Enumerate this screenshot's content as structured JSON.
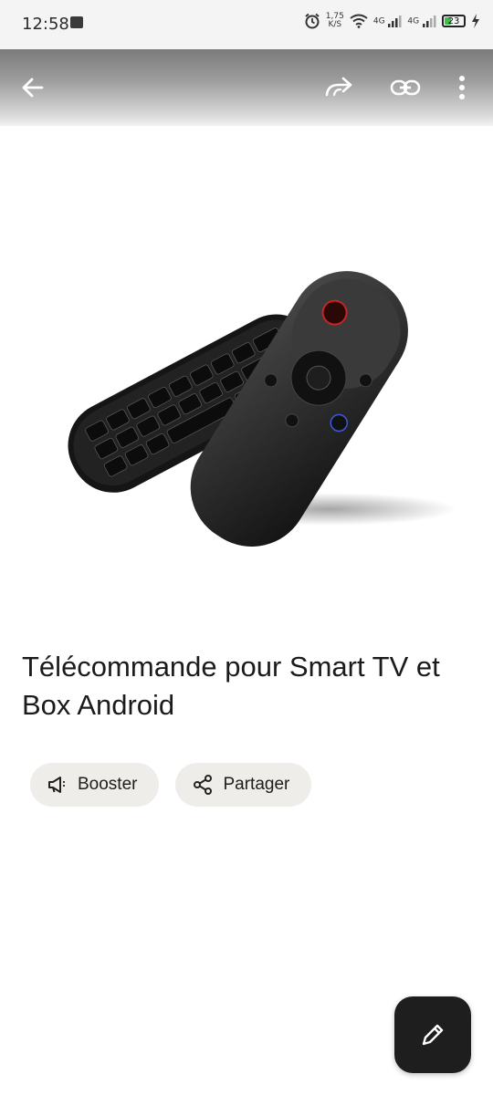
{
  "status_bar": {
    "time": "12:58",
    "speed_value": "1,75",
    "speed_unit": "K/S",
    "net1": "4G",
    "net2": "4G",
    "battery": "23"
  },
  "app_bar": {
    "icons": [
      "back-arrow-icon",
      "forward-icon",
      "link-icon",
      "more-vert-icon"
    ]
  },
  "product": {
    "title": "Télécommande pour Smart TV et Box Android",
    "image_alt": "remote-control-product-image"
  },
  "actions": {
    "boost_label": "Booster",
    "share_label": "Partager"
  },
  "fab": {
    "icon": "pencil-icon"
  },
  "colors": {
    "fab_bg": "#1e1e1e",
    "chip_bg": "#efedea",
    "battery_green": "#3bbf4a"
  }
}
